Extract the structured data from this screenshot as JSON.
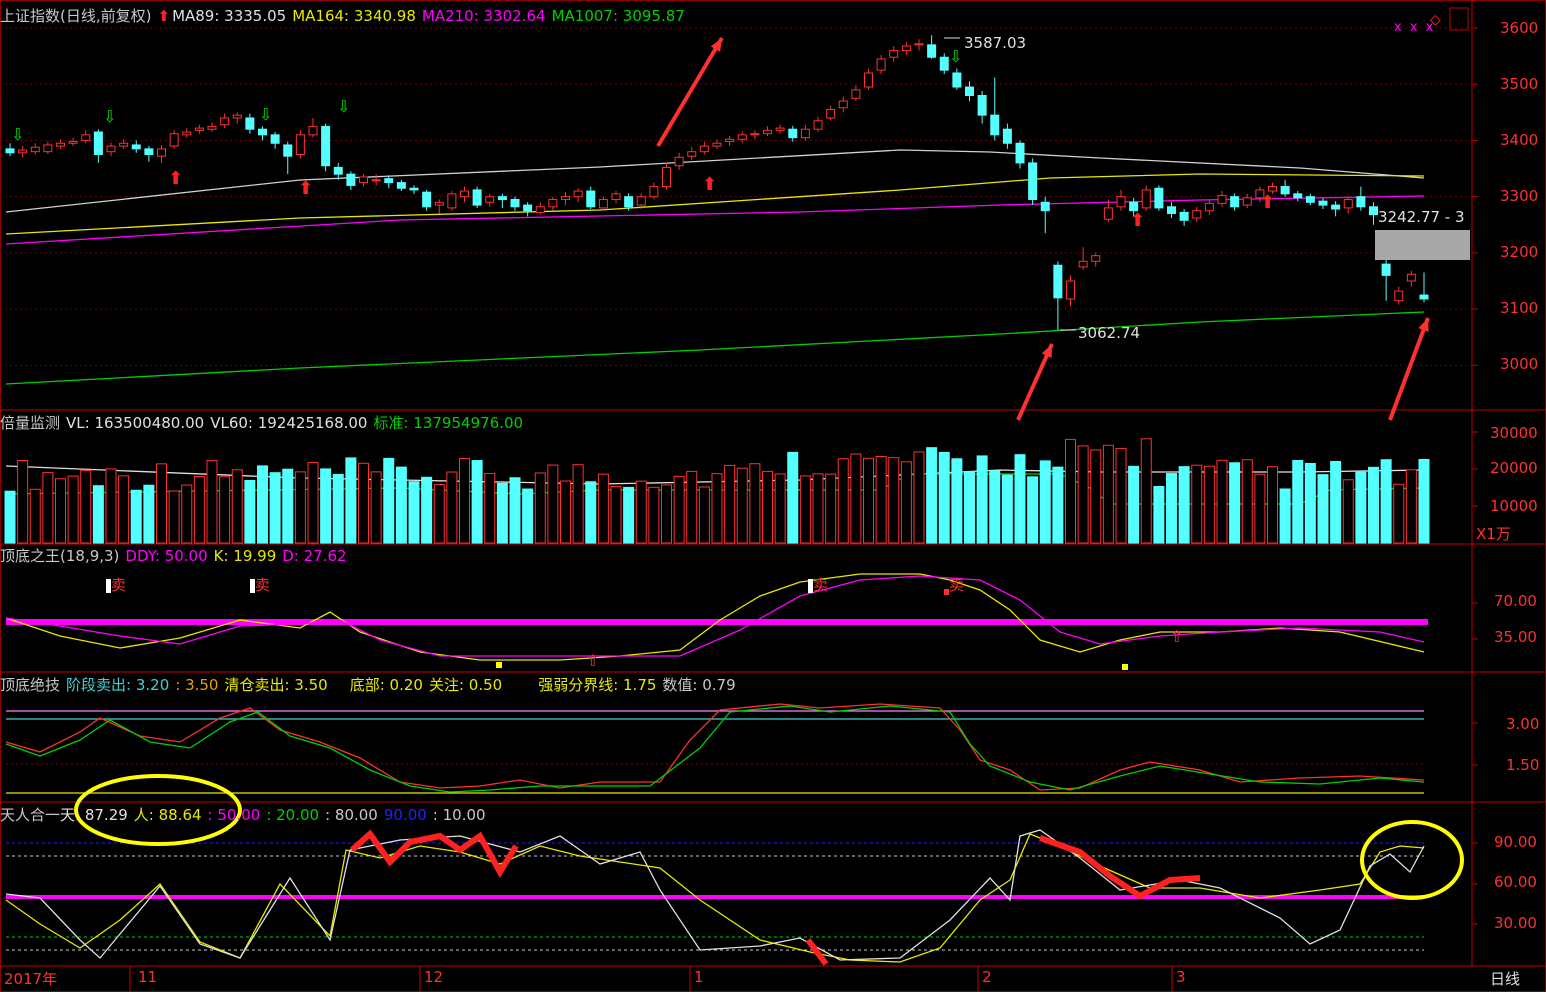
{
  "colors": {
    "up": "#ff3030",
    "down": "#54ffff",
    "bg": "#000000",
    "grid": "#8b0000",
    "white_line": "#d0d0d0",
    "yellow": "#e8e800",
    "magenta": "#ff00ff",
    "green": "#00d000",
    "blue": "#0000ff"
  },
  "main": {
    "title": "上证指数(日线,前复权)",
    "arrow_icon": "red-up-arrow-icon",
    "ma89_label": "MA89: 3335.05",
    "ma164_label": "MA164: 3340.98",
    "ma210_label": "MA210: 3302.64",
    "ma1007_label": "MA1007: 3095.87",
    "high_label": "3587.03",
    "low_label": "3062.74",
    "last_label": "3242.77 - 3",
    "yticks": [
      "3600",
      "3500",
      "3400",
      "3300",
      "3200",
      "3100",
      "3000"
    ],
    "markers": "x x x"
  },
  "volume": {
    "title": "倍量监测",
    "vl_label": "VL: 163500480.00",
    "vl60_label": "VL60: 192425168.00",
    "std_label": "标准: 137954976.00",
    "yticks": [
      "30000",
      "20000",
      "10000"
    ],
    "unit": "X1万"
  },
  "ddy": {
    "title": "顶底之王(18,9,3)",
    "ddy_label": "DDY: 50.00",
    "k_label": "K: 19.99",
    "d_label": "D: 27.62",
    "sell_text": "卖",
    "yticks": [
      "70.00",
      "35.00"
    ]
  },
  "jueji": {
    "title": "顶底绝技",
    "stage_sell": "阶段卖出: 3.20",
    "v350": ": 3.50",
    "clear_sell": "清仓卖出: 3.50",
    "bottom": "底部: 0.20",
    "focus": "关注: 0.50",
    "divider": "强弱分界线: 1.75",
    "value": "数值: 0.79",
    "yticks": [
      "3.00",
      "1.50"
    ]
  },
  "trh": {
    "title": "天人合一",
    "tian": "天: 87.29",
    "ren": "人: 88.64",
    "v50": ": 50.00",
    "v20": ": 20.00",
    "v80": ": 80.00",
    "v90": "90.00",
    "v10": ": 10.00",
    "yticks": [
      "90.00",
      "60.00",
      "30.00"
    ]
  },
  "xaxis": {
    "labels": [
      "2017年",
      "11",
      "12",
      "1",
      "2",
      "3"
    ],
    "period": "日线"
  },
  "chart_data": {
    "type": "candlestick",
    "title": "上证指数(日线,前复权)",
    "series": [
      {
        "name": "MA89",
        "last": 3335.05
      },
      {
        "name": "MA164",
        "last": 3340.98
      },
      {
        "name": "MA210",
        "last": 3302.64
      },
      {
        "name": "MA1007",
        "last": 3095.87
      }
    ],
    "annotations": {
      "high": 3587.03,
      "low": 3062.74,
      "last": "3242.77"
    },
    "ylim": [
      2920,
      3640
    ],
    "candles": [
      [
        3385,
        3378,
        3395,
        3372
      ],
      [
        3378,
        3383,
        3390,
        3370
      ],
      [
        3380,
        3388,
        3395,
        3375
      ],
      [
        3380,
        3392,
        3398,
        3376
      ],
      [
        3390,
        3395,
        3402,
        3385
      ],
      [
        3395,
        3398,
        3405,
        3390
      ],
      [
        3400,
        3410,
        3418,
        3395
      ],
      [
        3415,
        3375,
        3420,
        3360
      ],
      [
        3380,
        3390,
        3396,
        3372
      ],
      [
        3390,
        3395,
        3402,
        3385
      ],
      [
        3392,
        3385,
        3400,
        3378
      ],
      [
        3385,
        3375,
        3390,
        3362
      ],
      [
        3372,
        3385,
        3392,
        3360
      ],
      [
        3390,
        3412,
        3418,
        3385
      ],
      [
        3410,
        3415,
        3422,
        3405
      ],
      [
        3418,
        3422,
        3428,
        3412
      ],
      [
        3420,
        3425,
        3432,
        3415
      ],
      [
        3428,
        3440,
        3448,
        3422
      ],
      [
        3440,
        3445,
        3450,
        3430
      ],
      [
        3440,
        3420,
        3448,
        3412
      ],
      [
        3420,
        3410,
        3425,
        3400
      ],
      [
        3410,
        3395,
        3415,
        3385
      ],
      [
        3392,
        3372,
        3398,
        3340
      ],
      [
        3375,
        3410,
        3418,
        3368
      ],
      [
        3410,
        3425,
        3440,
        3405
      ],
      [
        3425,
        3355,
        3430,
        3345
      ],
      [
        3352,
        3340,
        3360,
        3330
      ],
      [
        3340,
        3320,
        3345,
        3312
      ],
      [
        3325,
        3335,
        3340,
        3318
      ],
      [
        3330,
        3330,
        3340,
        3320
      ],
      [
        3332,
        3325,
        3338,
        3315
      ],
      [
        3325,
        3315,
        3330,
        3310
      ],
      [
        3315,
        3312,
        3320,
        3305
      ],
      [
        3308,
        3282,
        3312,
        3275
      ],
      [
        3285,
        3290,
        3295,
        3270
      ],
      [
        3280,
        3305,
        3310,
        3275
      ],
      [
        3300,
        3310,
        3318,
        3290
      ],
      [
        3312,
        3285,
        3318,
        3280
      ],
      [
        3290,
        3300,
        3305,
        3282
      ],
      [
        3300,
        3295,
        3305,
        3280
      ],
      [
        3295,
        3282,
        3300,
        3275
      ],
      [
        3285,
        3275,
        3290,
        3265
      ],
      [
        3272,
        3282,
        3290,
        3268
      ],
      [
        3282,
        3295,
        3300,
        3275
      ],
      [
        3295,
        3300,
        3308,
        3285
      ],
      [
        3300,
        3310,
        3315,
        3290
      ],
      [
        3310,
        3282,
        3318,
        3278
      ],
      [
        3280,
        3295,
        3300,
        3275
      ],
      [
        3295,
        3305,
        3310,
        3288
      ],
      [
        3300,
        3282,
        3306,
        3275
      ],
      [
        3285,
        3300,
        3306,
        3278
      ],
      [
        3300,
        3318,
        3325,
        3295
      ],
      [
        3318,
        3352,
        3360,
        3312
      ],
      [
        3355,
        3370,
        3378,
        3348
      ],
      [
        3372,
        3380,
        3388,
        3365
      ],
      [
        3380,
        3390,
        3398,
        3375
      ],
      [
        3390,
        3395,
        3402,
        3385
      ],
      [
        3398,
        3402,
        3408,
        3390
      ],
      [
        3402,
        3410,
        3416,
        3396
      ],
      [
        3410,
        3412,
        3418,
        3402
      ],
      [
        3412,
        3418,
        3425,
        3408
      ],
      [
        3418,
        3422,
        3428,
        3412
      ],
      [
        3420,
        3405,
        3426,
        3398
      ],
      [
        3405,
        3420,
        3428,
        3400
      ],
      [
        3420,
        3435,
        3442,
        3415
      ],
      [
        3440,
        3455,
        3462,
        3435
      ],
      [
        3458,
        3470,
        3478,
        3450
      ],
      [
        3475,
        3490,
        3498,
        3470
      ],
      [
        3495,
        3520,
        3528,
        3490
      ],
      [
        3525,
        3545,
        3552,
        3518
      ],
      [
        3548,
        3560,
        3568,
        3540
      ],
      [
        3560,
        3568,
        3575,
        3552
      ],
      [
        3570,
        3572,
        3580,
        3560
      ],
      [
        3570,
        3548,
        3587,
        3545
      ],
      [
        3548,
        3525,
        3555,
        3518
      ],
      [
        3520,
        3495,
        3528,
        3490
      ],
      [
        3495,
        3480,
        3505,
        3470
      ],
      [
        3480,
        3445,
        3488,
        3430
      ],
      [
        3445,
        3410,
        3512,
        3400
      ],
      [
        3420,
        3395,
        3430,
        3385
      ],
      [
        3395,
        3360,
        3400,
        3350
      ],
      [
        3360,
        3295,
        3368,
        3285
      ],
      [
        3290,
        3275,
        3300,
        3235
      ],
      [
        3178,
        3120,
        3185,
        3062
      ],
      [
        3118,
        3150,
        3160,
        3105
      ],
      [
        3175,
        3185,
        3210,
        3170
      ],
      [
        3185,
        3195,
        3200,
        3175
      ],
      [
        3260,
        3280,
        3295,
        3255
      ],
      [
        3282,
        3300,
        3312,
        3275
      ],
      [
        3290,
        3275,
        3298,
        3265
      ],
      [
        3280,
        3312,
        3320,
        3275
      ],
      [
        3315,
        3280,
        3320,
        3275
      ],
      [
        3282,
        3270,
        3290,
        3262
      ],
      [
        3272,
        3258,
        3278,
        3248
      ],
      [
        3262,
        3275,
        3282,
        3255
      ],
      [
        3275,
        3288,
        3295,
        3268
      ],
      [
        3288,
        3302,
        3310,
        3282
      ],
      [
        3300,
        3282,
        3306,
        3275
      ],
      [
        3285,
        3298,
        3305,
        3280
      ],
      [
        3298,
        3312,
        3318,
        3290
      ],
      [
        3310,
        3318,
        3325,
        3305
      ],
      [
        3318,
        3305,
        3330,
        3300
      ],
      [
        3305,
        3298,
        3310,
        3292
      ],
      [
        3300,
        3290,
        3305,
        3285
      ],
      [
        3292,
        3285,
        3298,
        3278
      ],
      [
        3285,
        3278,
        3292,
        3265
      ],
      [
        3280,
        3295,
        3300,
        3270
      ],
      [
        3300,
        3282,
        3318,
        3275
      ],
      [
        3282,
        3268,
        3290,
        3250
      ],
      [
        3180,
        3160,
        3190,
        3115
      ],
      [
        3115,
        3132,
        3140,
        3108
      ],
      [
        3150,
        3162,
        3168,
        3140
      ],
      [
        3125,
        3118,
        3165,
        3112
      ]
    ],
    "volume": {
      "unit": "X1万",
      "yticks": [
        30000,
        20000,
        10000
      ]
    }
  }
}
